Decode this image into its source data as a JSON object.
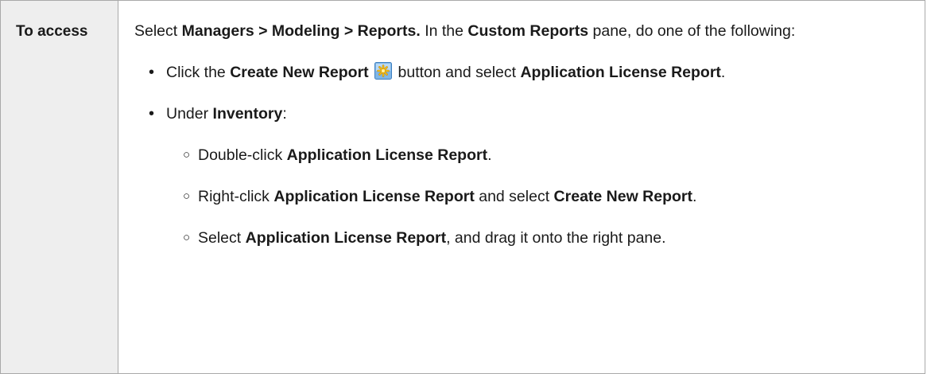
{
  "row": {
    "header": "To access",
    "intro": {
      "p1": "Select ",
      "p2": "Managers > Modeling > Reports.",
      "p3": " In the ",
      "p4": "Custom Reports",
      "p5": " pane, do one of the following:"
    },
    "bullets": [
      {
        "p1": "Click the ",
        "p2": "Create New Report",
        "icon": "create-new-report-icon",
        "p3": " button and select ",
        "p4": "Application License Report",
        "p5": "."
      },
      {
        "p1": "Under ",
        "p2": "Inventory",
        "p3": ":",
        "sub": [
          {
            "p1": "Double-click ",
            "p2": "Application License Report",
            "p3": "."
          },
          {
            "p1": "Right-click ",
            "p2": "Application License Report",
            "p3": " and select ",
            "p4": "Create New Report",
            "p5": "."
          },
          {
            "p1": "Select ",
            "p2": "Application License Report",
            "p3": ", and drag it onto the right pane."
          }
        ]
      }
    ]
  }
}
